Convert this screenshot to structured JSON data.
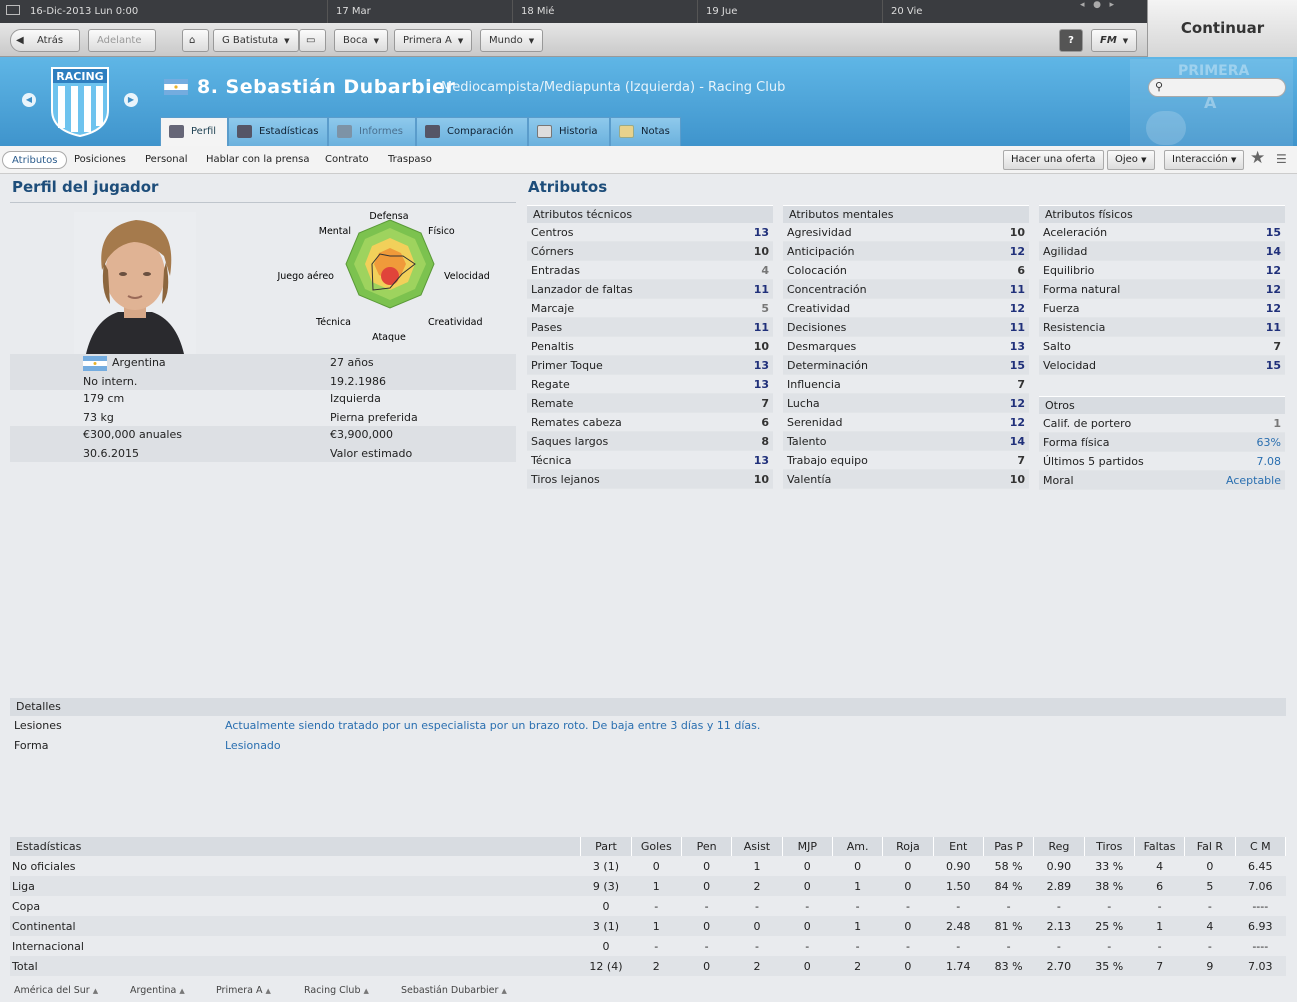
{
  "datebar": {
    "current": "16-Dic-2013 Lun 0:00",
    "days": [
      "17 Mar",
      "18 Mié",
      "19 Jue",
      "20 Vie"
    ]
  },
  "toolbar": {
    "back": "Atrás",
    "forward": "Adelante",
    "menus": [
      "G Batistuta",
      "Boca",
      "Primera A",
      "Mundo"
    ],
    "help": "?",
    "fm": "FM",
    "continue": "Continuar"
  },
  "header": {
    "club_badge": "RACING",
    "player_name": "8. Sebastián Dubarbier",
    "position": "Mediocampista/Mediapunta (Izquierda) - Racing Club",
    "league_badge": "PRIMERA",
    "league_sub": "A"
  },
  "tabs": [
    "Perfil",
    "Estadísticas",
    "Informes",
    "Comparación",
    "Historia",
    "Notas"
  ],
  "subtabs": [
    "Atributos",
    "Posiciones",
    "Personal",
    "Hablar con la prensa",
    "Contrato",
    "Traspaso"
  ],
  "actions": {
    "offer": "Hacer una oferta",
    "scout": "Ojeo",
    "interaction": "Interacción"
  },
  "profile": {
    "title": "Perfil del jugador",
    "radar_labels": {
      "top": "Defensa",
      "tr": "Físico",
      "r": "Velocidad",
      "br": "Creatividad",
      "b": "Ataque",
      "bl": "Técnica",
      "l": "Juego aéreo",
      "tl": "Mental"
    },
    "nationality": "Argentina",
    "intl": "No intern.",
    "age": "27 años",
    "dob": "19.2.1986",
    "height": "179 cm",
    "weight": "73 kg",
    "foot": "Izquierda",
    "foot_label": "Pierna preferida",
    "wage": "€300,000 anuales",
    "contract": "30.6.2015",
    "value": "€3,900,000",
    "value_label": "Valor estimado"
  },
  "attributes": {
    "title": "Atributos",
    "tecnicos": {
      "title": "Atributos técnicos",
      "rows": [
        [
          "Centros",
          "13"
        ],
        [
          "Córners",
          "10"
        ],
        [
          "Entradas",
          "4"
        ],
        [
          "Lanzador de faltas",
          "11"
        ],
        [
          "Marcaje",
          "5"
        ],
        [
          "Pases",
          "11"
        ],
        [
          "Penaltis",
          "10"
        ],
        [
          "Primer Toque",
          "13"
        ],
        [
          "Regate",
          "13"
        ],
        [
          "Remate",
          "7"
        ],
        [
          "Remates cabeza",
          "6"
        ],
        [
          "Saques largos",
          "8"
        ],
        [
          "Técnica",
          "13"
        ],
        [
          "Tiros lejanos",
          "10"
        ]
      ]
    },
    "mentales": {
      "title": "Atributos mentales",
      "rows": [
        [
          "Agresividad",
          "10"
        ],
        [
          "Anticipación",
          "12"
        ],
        [
          "Colocación",
          "6"
        ],
        [
          "Concentración",
          "11"
        ],
        [
          "Creatividad",
          "12"
        ],
        [
          "Decisiones",
          "11"
        ],
        [
          "Desmarques",
          "13"
        ],
        [
          "Determinación",
          "15"
        ],
        [
          "Influencia",
          "7"
        ],
        [
          "Lucha",
          "12"
        ],
        [
          "Serenidad",
          "12"
        ],
        [
          "Talento",
          "14"
        ],
        [
          "Trabajo equipo",
          "7"
        ],
        [
          "Valentía",
          "10"
        ]
      ]
    },
    "fisicos": {
      "title": "Atributos físicos",
      "rows": [
        [
          "Aceleración",
          "15"
        ],
        [
          "Agilidad",
          "14"
        ],
        [
          "Equilibrio",
          "12"
        ],
        [
          "Forma natural",
          "12"
        ],
        [
          "Fuerza",
          "12"
        ],
        [
          "Resistencia",
          "11"
        ],
        [
          "Salto",
          "7"
        ],
        [
          "Velocidad",
          "15"
        ]
      ]
    },
    "otros": {
      "title": "Otros",
      "rows": [
        [
          "Calif. de portero",
          "1"
        ],
        [
          "Forma física",
          "63%"
        ],
        [
          "Últimos 5 partidos",
          "7.08"
        ],
        [
          "Moral",
          "Aceptable"
        ]
      ]
    }
  },
  "details": {
    "title": "Detalles",
    "rows": [
      [
        "Lesiones",
        "Actualmente siendo tratado por un especialista por un brazo roto. De baja entre 3 días y 11 días."
      ],
      [
        "Forma",
        "Lesionado"
      ]
    ]
  },
  "stats": {
    "headers": [
      "Estadísticas",
      "Part",
      "Goles",
      "Pen",
      "Asist",
      "MJP",
      "Am.",
      "Roja",
      "Ent",
      "Pas P",
      "Reg",
      "Tiros",
      "Faltas",
      "Fal R",
      "C M"
    ],
    "rows": [
      [
        "No oficiales",
        "3 (1)",
        "0",
        "0",
        "1",
        "0",
        "0",
        "0",
        "0.90",
        "58 %",
        "0.90",
        "33 %",
        "4",
        "0",
        "6.45"
      ],
      [
        "Liga",
        "9 (3)",
        "1",
        "0",
        "2",
        "0",
        "1",
        "0",
        "1.50",
        "84 %",
        "2.89",
        "38 %",
        "6",
        "5",
        "7.06"
      ],
      [
        "Copa",
        "0",
        "-",
        "-",
        "-",
        "-",
        "-",
        "-",
        "-",
        "-",
        "-",
        "-",
        "-",
        "-",
        "----"
      ],
      [
        "Continental",
        "3 (1)",
        "1",
        "0",
        "0",
        "0",
        "1",
        "0",
        "2.48",
        "81 %",
        "2.13",
        "25 %",
        "1",
        "4",
        "6.93"
      ],
      [
        "Internacional",
        "0",
        "-",
        "-",
        "-",
        "-",
        "-",
        "-",
        "-",
        "-",
        "-",
        "-",
        "-",
        "-",
        "----"
      ],
      [
        "Total",
        "12 (4)",
        "2",
        "0",
        "2",
        "0",
        "2",
        "0",
        "1.74",
        "83 %",
        "2.70",
        "35 %",
        "7",
        "9",
        "7.03"
      ]
    ]
  },
  "breadcrumb": [
    "América del Sur",
    "Argentina",
    "Primera A",
    "Racing Club",
    "Sebastián Dubarbier"
  ]
}
